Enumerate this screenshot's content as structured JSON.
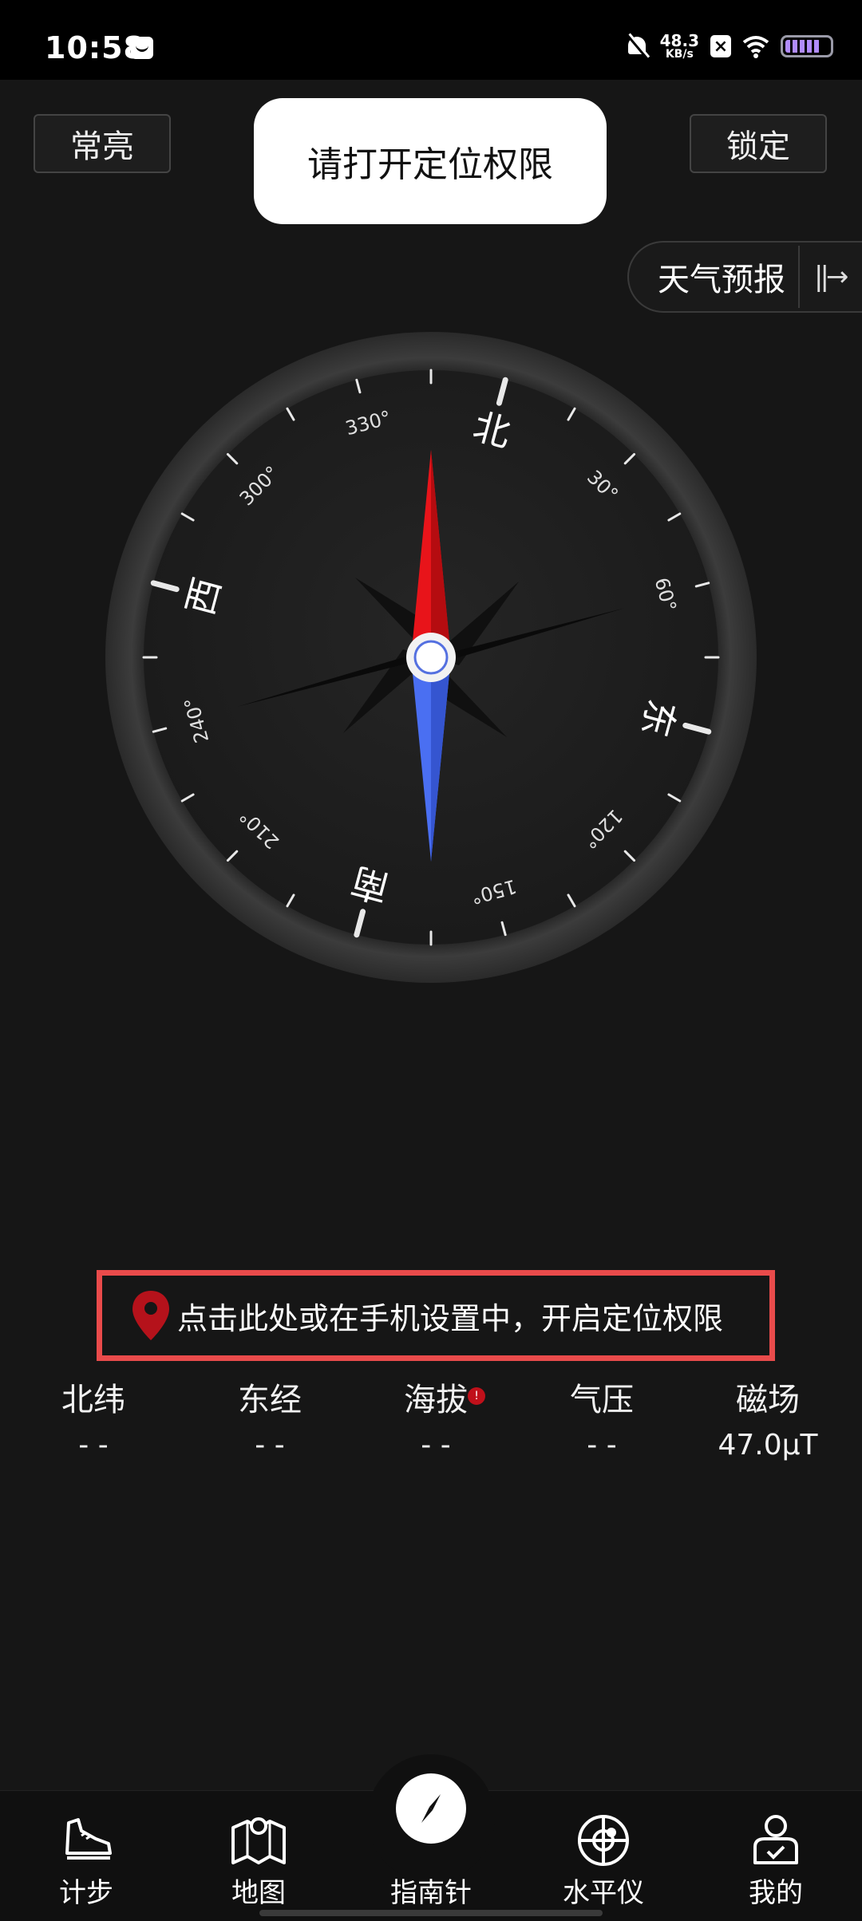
{
  "status_bar": {
    "time": "10:58",
    "net_speed_value": "48.3",
    "net_speed_unit": "KB/s",
    "sim_badge": "×"
  },
  "header": {
    "always_on_label": "常亮",
    "lock_label": "锁定",
    "toast_message": "请打开定位权限",
    "weather_label": "天气预报",
    "weather_arrow": "||→"
  },
  "compass": {
    "north": "北",
    "east": "东",
    "south": "南",
    "west": "西",
    "degree_labels": [
      "30°",
      "60°",
      "120°",
      "150°",
      "210°",
      "240°",
      "300°",
      "330°"
    ],
    "needle_north_color": "#e8141a",
    "needle_south_color": "#4a6ff2"
  },
  "location_warning": {
    "text": "点击此处或在手机设置中，开启定位权限",
    "accent_color": "#e94b4b",
    "icon": "map-pin-icon"
  },
  "info": {
    "latitude": {
      "label": "北纬",
      "value": "- -"
    },
    "longitude": {
      "label": "东经",
      "value": "- -"
    },
    "altitude": {
      "label": "海拔",
      "value": "- -",
      "badge": "!"
    },
    "pressure": {
      "label": "气压",
      "value": "- -"
    },
    "magnetic": {
      "label": "磁场",
      "value": "47.0μT"
    }
  },
  "bottom_nav": {
    "items": [
      {
        "label": "计步",
        "icon": "shoe-icon"
      },
      {
        "label": "地图",
        "icon": "map-icon"
      },
      {
        "label": "指南针",
        "icon": "compass-icon"
      },
      {
        "label": "水平仪",
        "icon": "level-icon"
      },
      {
        "label": "我的",
        "icon": "profile-icon"
      }
    ]
  }
}
